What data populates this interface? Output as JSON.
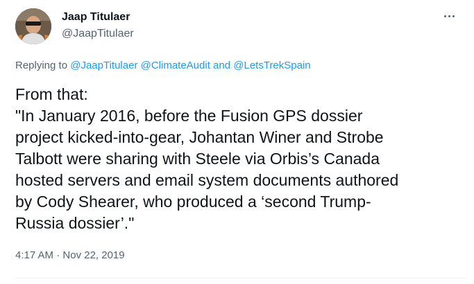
{
  "author": {
    "name": "Jaap Titulaer",
    "handle": "@JaapTitulaer"
  },
  "reply": {
    "prefix": "Replying to ",
    "mentions": [
      "@JaapTitulaer",
      "@ClimateAudit",
      "@LetsTrekSpain"
    ],
    "and": " and "
  },
  "body": {
    "lines": [
      "From that:",
      "\"In January 2016, before the Fusion GPS dossier",
      "project kicked-into-gear, Johantan Winer and Strobe",
      "Talbott were sharing with Steele via Orbis’s Canada",
      "hosted servers and email system documents authored",
      "by Cody Shearer, who produced a ‘second Trump-",
      "Russia dossier’.\""
    ]
  },
  "meta": {
    "time": "4:17 AM",
    "separator": " · ",
    "date": "Nov 22, 2019"
  },
  "icons": {
    "more": "more-options-icon"
  },
  "colors": {
    "text": "#0f1419",
    "secondary": "#536471",
    "link": "#1d9bf0"
  }
}
